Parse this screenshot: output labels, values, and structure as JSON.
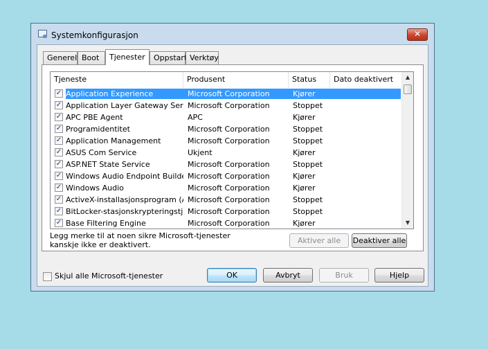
{
  "window": {
    "title": "Systemkonfigurasjon",
    "close_glyph": "✕"
  },
  "tabs": [
    {
      "label": "Generelt"
    },
    {
      "label": "Boot"
    },
    {
      "label": "Tjenester"
    },
    {
      "label": "Oppstart"
    },
    {
      "label": "Verktøy"
    }
  ],
  "active_tab": "Tjenester",
  "columns": {
    "service": "Tjeneste",
    "maker": "Produsent",
    "status": "Status",
    "date": "Dato deaktivert"
  },
  "services": [
    {
      "name": "Application Experience",
      "maker": "Microsoft Corporation",
      "status": "Kjører",
      "date": "",
      "checked": true,
      "selected": true
    },
    {
      "name": "Application Layer Gateway Service",
      "maker": "Microsoft Corporation",
      "status": "Stoppet",
      "date": "",
      "checked": true
    },
    {
      "name": "APC PBE Agent",
      "maker": "APC",
      "status": "Kjører",
      "date": "",
      "checked": true
    },
    {
      "name": "Programidentitet",
      "maker": "Microsoft Corporation",
      "status": "Stoppet",
      "date": "",
      "checked": true
    },
    {
      "name": "Application Management",
      "maker": "Microsoft Corporation",
      "status": "Stoppet",
      "date": "",
      "checked": true
    },
    {
      "name": "ASUS Com Service",
      "maker": "Ukjent",
      "status": "Kjører",
      "date": "",
      "checked": true
    },
    {
      "name": "ASP.NET State Service",
      "maker": "Microsoft Corporation",
      "status": "Stoppet",
      "date": "",
      "checked": true
    },
    {
      "name": "Windows Audio Endpoint Builder",
      "maker": "Microsoft Corporation",
      "status": "Kjører",
      "date": "",
      "checked": true
    },
    {
      "name": "Windows Audio",
      "maker": "Microsoft Corporation",
      "status": "Kjører",
      "date": "",
      "checked": true
    },
    {
      "name": "ActiveX-installasjonsprogram (A...",
      "maker": "Microsoft Corporation",
      "status": "Stoppet",
      "date": "",
      "checked": true
    },
    {
      "name": "BitLocker-stasjonskrypteringstje...",
      "maker": "Microsoft Corporation",
      "status": "Stoppet",
      "date": "",
      "checked": true
    },
    {
      "name": "Base Filtering Engine",
      "maker": "Microsoft Corporation",
      "status": "Kjører",
      "date": "",
      "checked": true
    }
  ],
  "note": "Legg merke til at noen sikre Microsoft-tjenester kanskje ikke er deaktivert.",
  "buttons": {
    "enable_all": "Aktiver alle",
    "disable_all": "Deaktiver alle",
    "ok": "OK",
    "cancel": "Avbryt",
    "apply": "Bruk",
    "help": "Hjelp"
  },
  "hide_ms_label": "Skjul alle Microsoft-tjenester",
  "hide_ms_checked": false,
  "check_glyph": "✓",
  "scroll": {
    "up_glyph": "▲",
    "down_glyph": "▼"
  }
}
